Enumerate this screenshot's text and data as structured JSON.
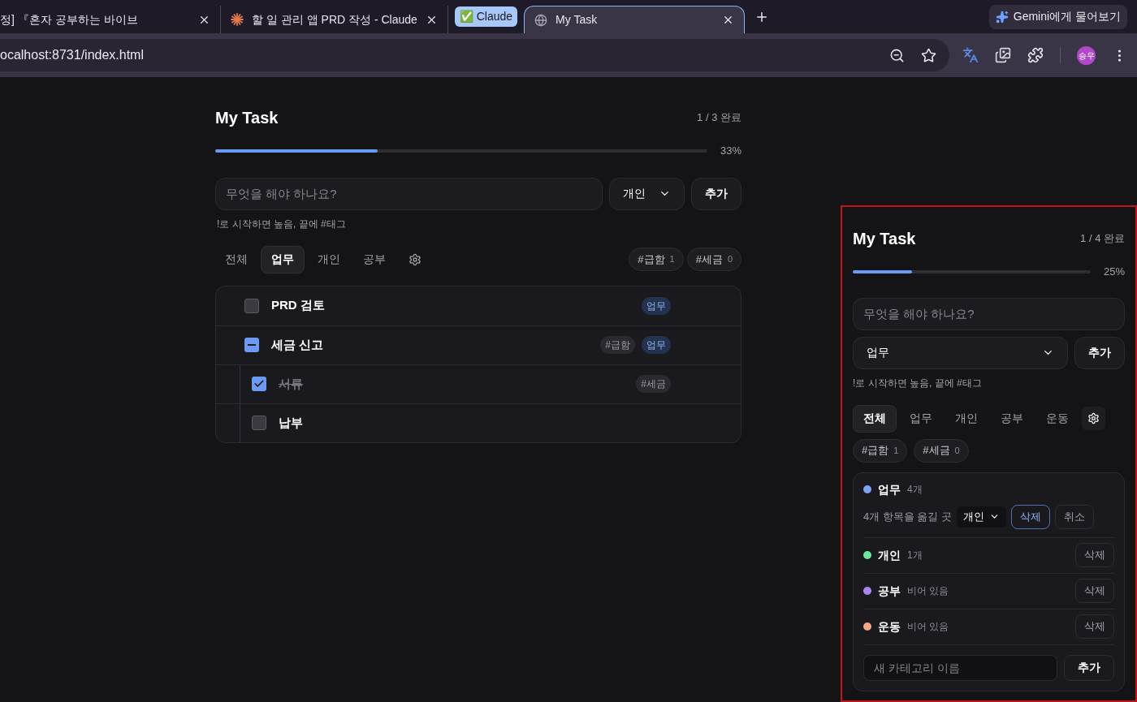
{
  "browser": {
    "tabs": [
      {
        "title": "정] 『혼자 공부하는 바이브",
        "kind": "page",
        "selected": false
      },
      {
        "title": "할 일 관리 앱 PRD 작성 - Claude",
        "kind": "claude",
        "selected": false
      },
      {
        "title": "✅ Claude",
        "kind": "group",
        "selected": false
      },
      {
        "title": "My Task",
        "kind": "globe",
        "selected": true
      }
    ],
    "gemini": "Gemini에게 물어보기",
    "address": "ocalhost:8731/index.html",
    "profile": "승우"
  },
  "main": {
    "title": "My Task",
    "done_text": "1 / 3 완료",
    "level": 0.33,
    "percent": "33%",
    "input": {
      "placeholder": "무엇을 해야 하나요?"
    },
    "category": "개인",
    "add": "추가",
    "hint": "!로 시작하면 높음, 끝에 #태그",
    "filters": [
      {
        "label": "전체",
        "selected": false
      },
      {
        "label": "업무",
        "selected": true
      },
      {
        "label": "개인",
        "selected": false
      },
      {
        "label": "공부",
        "selected": false
      }
    ],
    "tags": [
      {
        "label": "#급함",
        "count": "1"
      },
      {
        "label": "#세금",
        "count": "0"
      }
    ],
    "tasks": [
      {
        "title": "PRD 검토",
        "checked": false,
        "category": "업무"
      },
      {
        "title": "세금 신고",
        "checked": false,
        "mixed": true,
        "tags": [
          "#급함"
        ],
        "category": "업무",
        "children": [
          {
            "title": "서류",
            "checked": true,
            "tags": [
              "#세금"
            ]
          },
          {
            "title": "납부",
            "checked": false
          }
        ]
      }
    ]
  },
  "panel": {
    "title": "My Task",
    "done_text": "1 / 4 완료",
    "level": 0.25,
    "percent": "25%",
    "input": {
      "placeholder": "무엇을 해야 하나요?"
    },
    "category": "업무",
    "add": "추가",
    "hint": "!로 시작하면 높음, 끝에 #태그",
    "filters": [
      {
        "label": "전체",
        "selected": true
      },
      {
        "label": "업무",
        "selected": false
      },
      {
        "label": "개인",
        "selected": false
      },
      {
        "label": "공부",
        "selected": false
      },
      {
        "label": "운동",
        "selected": false
      }
    ],
    "tags": [
      {
        "label": "#급함",
        "count": "1"
      },
      {
        "label": "#세금",
        "count": "0"
      }
    ],
    "categories": [
      {
        "name": "업무",
        "count": "4개",
        "color": "#7da2f5",
        "deleting": true,
        "move_label": "4개 항목을 옮길 곳",
        "move_target": "개인",
        "delete": "삭제",
        "cancel": "취소"
      },
      {
        "name": "개인",
        "count": "1개",
        "color": "#6ee79a",
        "deleting": false,
        "delete": "삭제"
      },
      {
        "name": "공부",
        "count": "비어 있음",
        "color": "#a985f0",
        "deleting": false,
        "delete": "삭제"
      },
      {
        "name": "운동",
        "count": "비어 있음",
        "color": "#f5a57f",
        "deleting": false,
        "delete": "삭제"
      }
    ],
    "new_category": {
      "placeholder": "새 카테고리 이름"
    },
    "new_add": "추가"
  }
}
